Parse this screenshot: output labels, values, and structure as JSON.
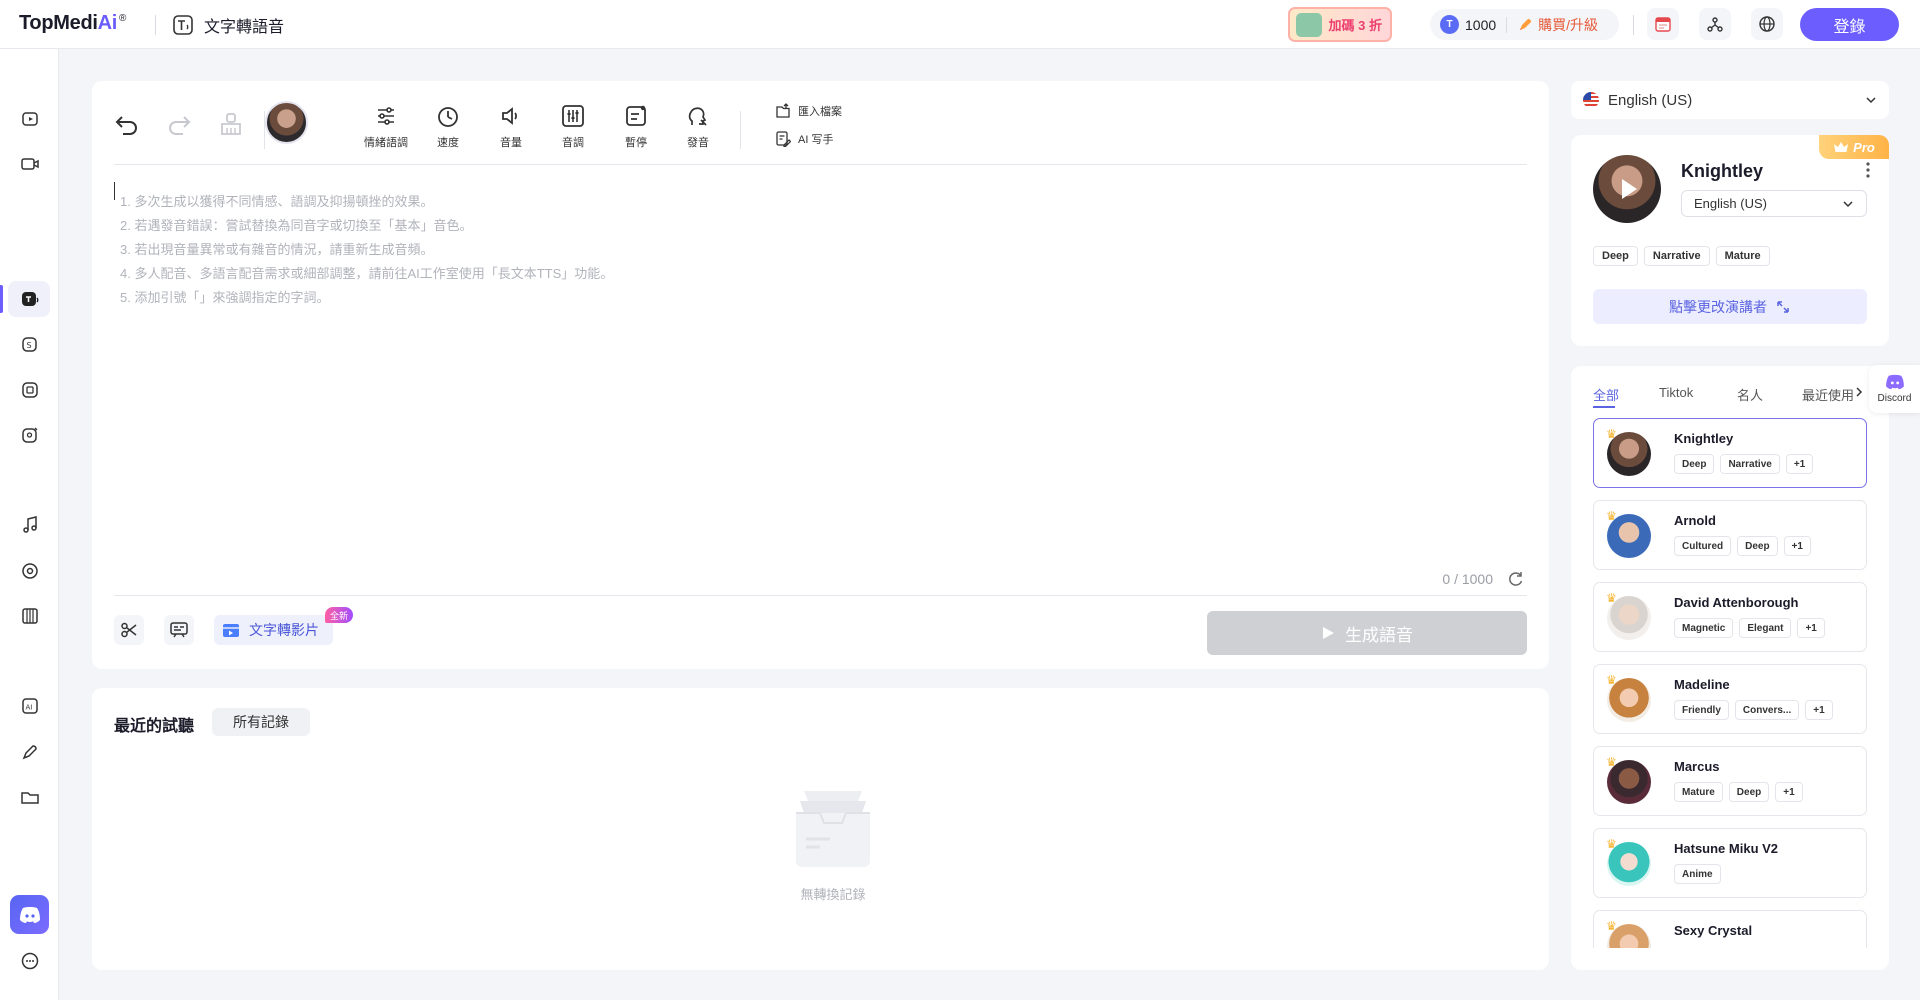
{
  "header": {
    "logo_text": "TopMedi",
    "logo_ai": "Ai",
    "logo_reg": "®",
    "tool_title": "文字轉語音",
    "promo_label": "加碼 3 折",
    "credits": "1000",
    "buy_label": "購買/升級",
    "login_label": "登錄"
  },
  "editor": {
    "toolbar": [
      {
        "label": "情緒語調",
        "icon": "sliders-icon"
      },
      {
        "label": "速度",
        "icon": "speed-icon"
      },
      {
        "label": "音量",
        "icon": "volume-icon"
      },
      {
        "label": "音調",
        "icon": "pitch-icon"
      },
      {
        "label": "暫停",
        "icon": "pause-insert-icon"
      },
      {
        "label": "發音",
        "icon": "pronunciation-icon"
      }
    ],
    "import_label": "匯入檔案",
    "ai_writer_label": "AI 写手",
    "hints": [
      "1. 多次生成以獲得不同情感、語調及抑揚頓挫的效果。",
      "2. 若遇發音錯誤：嘗試替換為同音字或切換至「基本」音色。",
      "3. 若出現音量異常或有雜音的情況，請重新生成音頻。",
      "4. 多人配音、多語言配音需求或細部調整，請前往AI工作室使用「長文本TTS」功能。",
      "5. 添加引號「」來強調指定的字詞。"
    ],
    "counter": "0 / 1000",
    "text_to_video_label": "文字轉影片",
    "new_badge": "全新",
    "generate_label": "生成語音"
  },
  "history": {
    "title": "最近的試聽",
    "all_records_label": "所有記錄",
    "empty_text": "無轉換記錄"
  },
  "right": {
    "language": "English (US)",
    "voice": {
      "name": "Knightley",
      "pro_label": "Pro",
      "language": "English (US)",
      "tags": [
        "Deep",
        "Narrative",
        "Mature"
      ],
      "change_label": "點擊更改演講者"
    },
    "tabs": [
      "全部",
      "Tiktok",
      "名人",
      "最近使用"
    ],
    "voices": [
      {
        "name": "Knightley",
        "tags": [
          "Deep",
          "Narrative",
          "+1"
        ]
      },
      {
        "name": "Arnold",
        "tags": [
          "Cultured",
          "Deep",
          "+1"
        ]
      },
      {
        "name": "David Attenborough",
        "tags": [
          "Magnetic",
          "Elegant",
          "+1"
        ]
      },
      {
        "name": "Madeline",
        "tags": [
          "Friendly",
          "Convers...",
          "+1"
        ]
      },
      {
        "name": "Marcus",
        "tags": [
          "Mature",
          "Deep",
          "+1"
        ]
      },
      {
        "name": "Hatsune Miku V2",
        "tags": [
          "Anime"
        ]
      },
      {
        "name": "Sexy Crystal",
        "tags": []
      }
    ],
    "discord_label": "Discord"
  }
}
